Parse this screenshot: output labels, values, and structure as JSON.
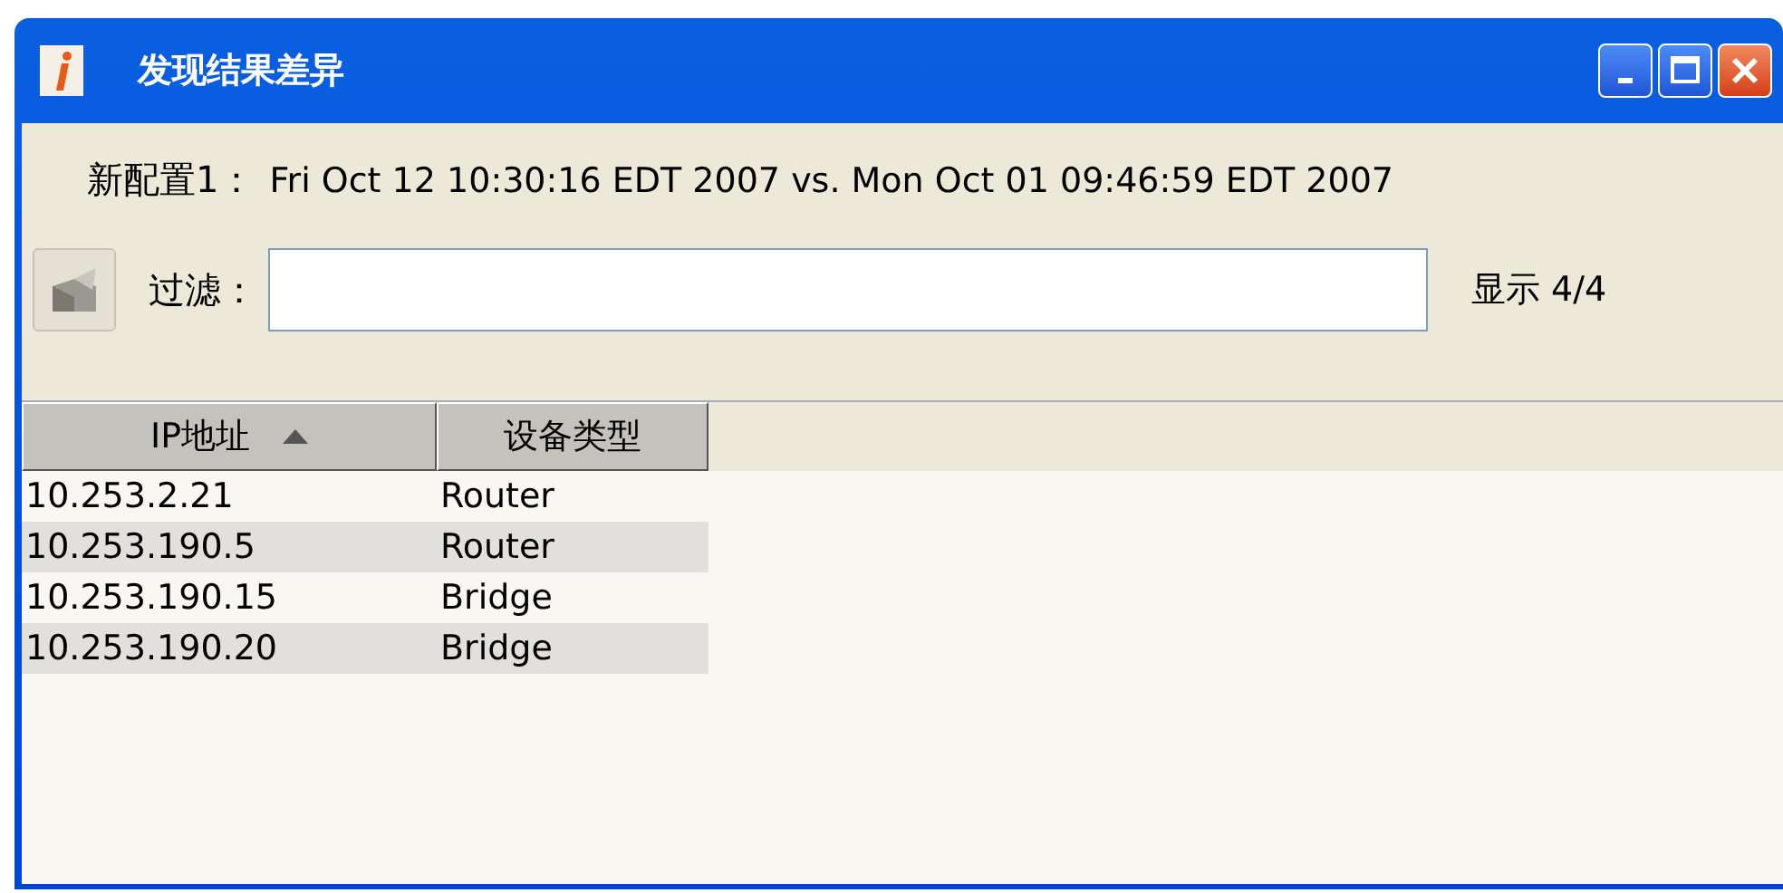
{
  "window": {
    "title": "发现结果差异"
  },
  "comparison": {
    "label": "新配置1：",
    "text": "Fri Oct 12 10:30:16 EDT 2007 vs. Mon Oct 01 09:46:59 EDT 2007"
  },
  "filter": {
    "label": "过滤：",
    "count": "显示 4/4"
  },
  "table": {
    "columns": [
      {
        "label": "IP地址",
        "sorted": true
      },
      {
        "label": "设备类型",
        "sorted": false
      }
    ],
    "rows": [
      [
        "10.253.2.21",
        "Router"
      ],
      [
        "10.253.190.5",
        "Router"
      ],
      [
        "10.253.190.15",
        "Bridge"
      ],
      [
        "10.253.190.20",
        "Bridge"
      ]
    ]
  }
}
